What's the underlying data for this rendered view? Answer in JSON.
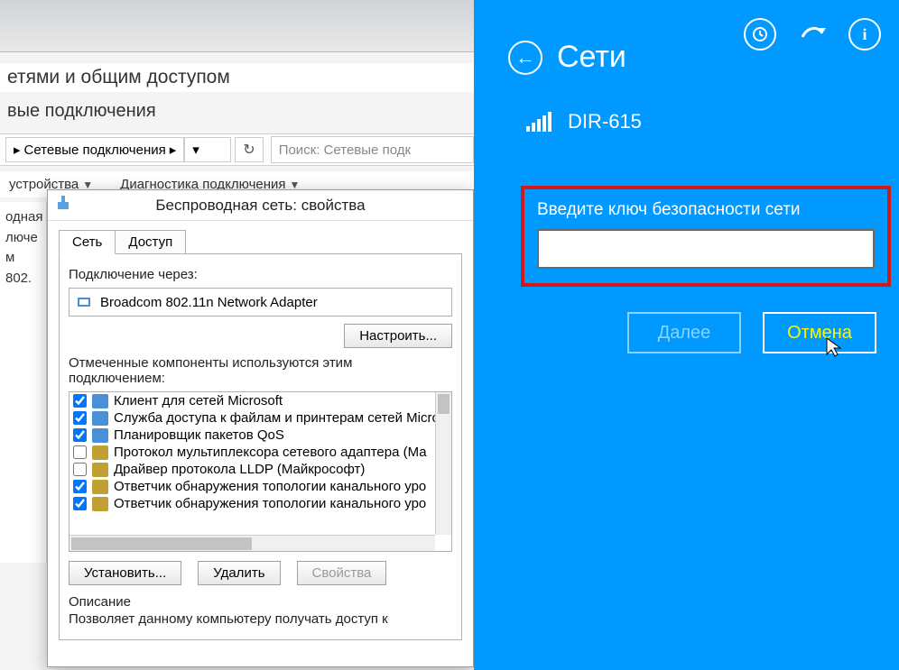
{
  "explorer": {
    "title_partial": "етями и общим доступом",
    "subtitle_partial": "вые подключения",
    "breadcrumb": "Сетевые подключения",
    "search_placeholder": "Поиск: Сетевые подк",
    "menu1": "устройства",
    "menu2": "Диагностика подключения",
    "side1": "одная",
    "side2": "лючe",
    "side3": "м 802."
  },
  "props": {
    "window_title": "Беспроводная сеть: свойства",
    "tab_network": "Сеть",
    "tab_access": "Доступ",
    "connect_via_label": "Подключение через:",
    "adapter": "Broadcom 802.11n Network Adapter",
    "configure_btn": "Настроить...",
    "components_label": "Отмеченные компоненты используются этим подключением:",
    "items": [
      {
        "checked": true,
        "icon": "b",
        "text": "Клиент для сетей Microsoft"
      },
      {
        "checked": true,
        "icon": "b",
        "text": "Служба доступа к файлам и принтерам сетей Micro"
      },
      {
        "checked": true,
        "icon": "b",
        "text": "Планировщик пакетов QoS"
      },
      {
        "checked": false,
        "icon": "y",
        "text": "Протокол мультиплексора сетевого адаптера (Ма"
      },
      {
        "checked": false,
        "icon": "y",
        "text": "Драйвер протокола LLDP (Майкрософт)"
      },
      {
        "checked": true,
        "icon": "y",
        "text": "Ответчик обнаружения топологии канального уро"
      },
      {
        "checked": true,
        "icon": "y",
        "text": "Ответчик обнаружения топологии канального уро"
      }
    ],
    "install_btn": "Установить...",
    "remove_btn": "Удалить",
    "props_btn": "Свойства",
    "desc_header": "Описание",
    "desc_text": "Позволяет данному компьютеру получать доступ к"
  },
  "networks": {
    "title": "Сети",
    "ssid": "DIR-615",
    "key_label": "Введите ключ безопасности сети",
    "next_btn": "Далее",
    "cancel_btn": "Отмена"
  }
}
